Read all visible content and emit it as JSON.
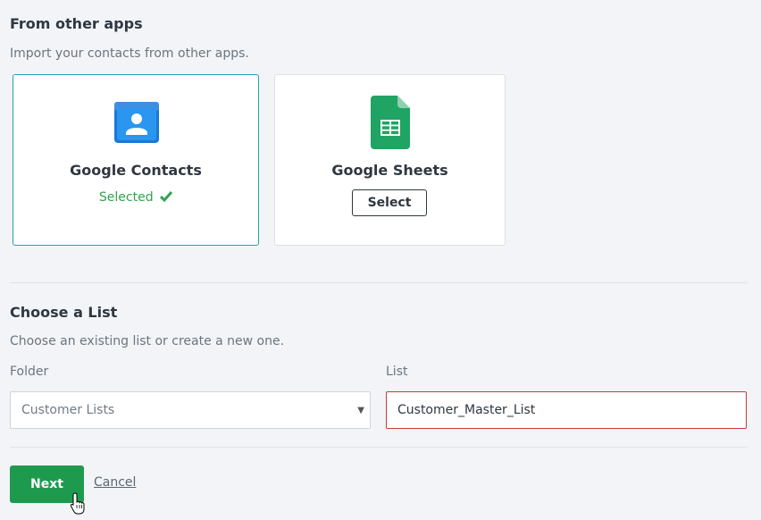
{
  "apps_section": {
    "title": "From other apps",
    "description": "Import your contacts from other apps."
  },
  "cards": [
    {
      "title": "Google Contacts",
      "icon": "google-contacts-icon",
      "status": "Selected",
      "selected": true
    },
    {
      "title": "Google Sheets",
      "icon": "google-sheets-icon",
      "button_label": "Select",
      "selected": false
    }
  ],
  "list_section": {
    "title": "Choose a List",
    "description": "Choose an existing list or create a new one.",
    "folder_label": "Folder",
    "folder_value": "Customer Lists",
    "list_label": "List",
    "list_value": "Customer_Master_List"
  },
  "actions": {
    "next_label": "Next",
    "cancel_label": "Cancel"
  },
  "colors": {
    "accent": "#20a2b4",
    "success": "#2ea44f",
    "primary_button": "#1e9a4f",
    "error_border": "#c73a3a"
  }
}
